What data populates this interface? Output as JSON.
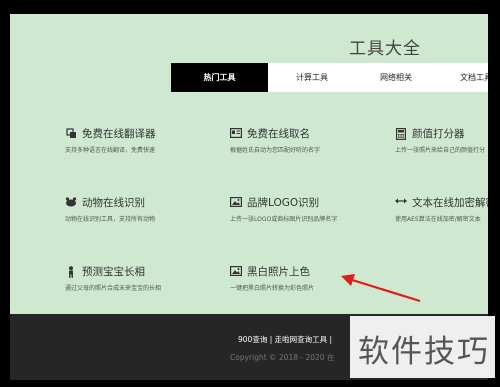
{
  "site": {
    "title": "工具大全"
  },
  "tabs": [
    {
      "label": "热门工具",
      "active": true
    },
    {
      "label": "计算工具",
      "active": false
    },
    {
      "label": "网络相关",
      "active": false
    },
    {
      "label": "文档工具",
      "active": false
    }
  ],
  "tools": [
    {
      "name": "免费在线翻译器",
      "desc": "支持多种语言在线翻译，免费快速",
      "icon": "translate-icon"
    },
    {
      "name": "免费在线取名",
      "desc": "根据姓氏自动为您匹配好听的名字",
      "icon": "id-card-icon"
    },
    {
      "name": "颜值打分器",
      "desc": "上传一张照片来给自己的颜值打分",
      "icon": "calculator-icon"
    },
    {
      "name": "动物在线识别",
      "desc": "动物在线识别工具，支持所有动物",
      "icon": "animal-icon"
    },
    {
      "name": "品牌LOGO识别",
      "desc": "上传一张LOGO或商标图片识别品牌名字",
      "icon": "image-icon"
    },
    {
      "name": "文本在线加密解密",
      "desc": "使用AES算法在线加密/解密文本",
      "icon": "swap-icon"
    },
    {
      "name": "预测宝宝长相",
      "desc": "通过父母的照片合成未来宝宝的长相",
      "icon": "baby-icon"
    },
    {
      "name": "黑白照片上色",
      "desc": "一键把黑白照片转换为彩色照片",
      "icon": "photo-icon"
    }
  ],
  "footer": {
    "links": "900查询 | 走啦网查询工具 |",
    "copyright": "Copyright © 2018 - 2020 在"
  },
  "watermark": {
    "text": "软件技巧"
  },
  "colors": {
    "page_bg": "#cfe9d0",
    "footer_bg": "#262626",
    "active_tab_bg": "#000000",
    "arrow": "#e01b1b"
  }
}
